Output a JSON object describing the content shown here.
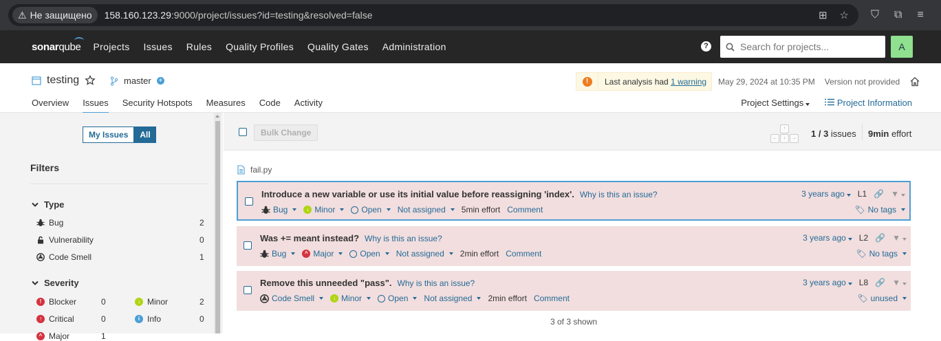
{
  "browser": {
    "security_label": "Не защищено",
    "url_host": "158.160.123.29",
    "url_rest": ":9000/project/issues?id=testing&resolved=false"
  },
  "topnav": {
    "logo_sonar": "sonar",
    "logo_qube": "qube",
    "items": [
      "Projects",
      "Issues",
      "Rules",
      "Quality Profiles",
      "Quality Gates",
      "Administration"
    ],
    "search_placeholder": "Search for projects...",
    "avatar_letter": "A",
    "help_glyph": "?"
  },
  "project": {
    "name": "testing",
    "branch": "master",
    "warning_text": "Last analysis had ",
    "warning_link": "1 warning",
    "analysis_date": "May 29, 2024 at 10:35 PM",
    "version": "Version not provided",
    "tabs": [
      "Overview",
      "Issues",
      "Security Hotspots",
      "Measures",
      "Code",
      "Activity"
    ],
    "active_tab": "Issues",
    "settings_label": "Project Settings",
    "info_label": "Project Information"
  },
  "sidebar": {
    "my_issues": "My Issues",
    "all": "All",
    "filters_title": "Filters",
    "type_title": "Type",
    "types": [
      {
        "label": "Bug",
        "count": "2"
      },
      {
        "label": "Vulnerability",
        "count": "0"
      },
      {
        "label": "Code Smell",
        "count": "1"
      }
    ],
    "severity_title": "Severity",
    "severities": [
      {
        "label": "Blocker",
        "count": "0",
        "color": "#d4333f"
      },
      {
        "label": "Minor",
        "count": "2",
        "color": "#b0d513"
      },
      {
        "label": "Critical",
        "count": "0",
        "color": "#d4333f"
      },
      {
        "label": "Info",
        "count": "0",
        "color": "#4b9fd5"
      },
      {
        "label": "Major",
        "count": "1",
        "color": "#d4333f"
      }
    ]
  },
  "toolbar": {
    "bulk_change": "Bulk Change",
    "count_shown": "1 / 3",
    "count_label": " issues",
    "effort_value": "9min",
    "effort_label": " effort"
  },
  "file": "fail.py",
  "issues": [
    {
      "message": "Introduce a new variable or use its initial value before reassigning 'index'.",
      "why": "Why is this an issue?",
      "type": "Bug",
      "severity": "Minor",
      "status": "Open",
      "assignee": "Not assigned",
      "effort": "5min effort",
      "comment": "Comment",
      "age": "3 years ago",
      "line": "L1",
      "tags": "No tags"
    },
    {
      "message": "Was += meant instead?",
      "why": "Why is this an issue?",
      "type": "Bug",
      "severity": "Major",
      "status": "Open",
      "assignee": "Not assigned",
      "effort": "2min effort",
      "comment": "Comment",
      "age": "3 years ago",
      "line": "L2",
      "tags": "No tags"
    },
    {
      "message": "Remove this unneeded \"pass\".",
      "why": "Why is this an issue?",
      "type": "Code Smell",
      "severity": "Minor",
      "status": "Open",
      "assignee": "Not assigned",
      "effort": "2min effort",
      "comment": "Comment",
      "age": "3 years ago",
      "line": "L8",
      "tags": "unused"
    }
  ],
  "shown_text": "3 of 3 shown",
  "colors": {
    "accent": "#236a97",
    "issue_bg": "#f2dede",
    "topbar": "#262626",
    "minor": "#b0d513",
    "major": "#d4333f"
  }
}
